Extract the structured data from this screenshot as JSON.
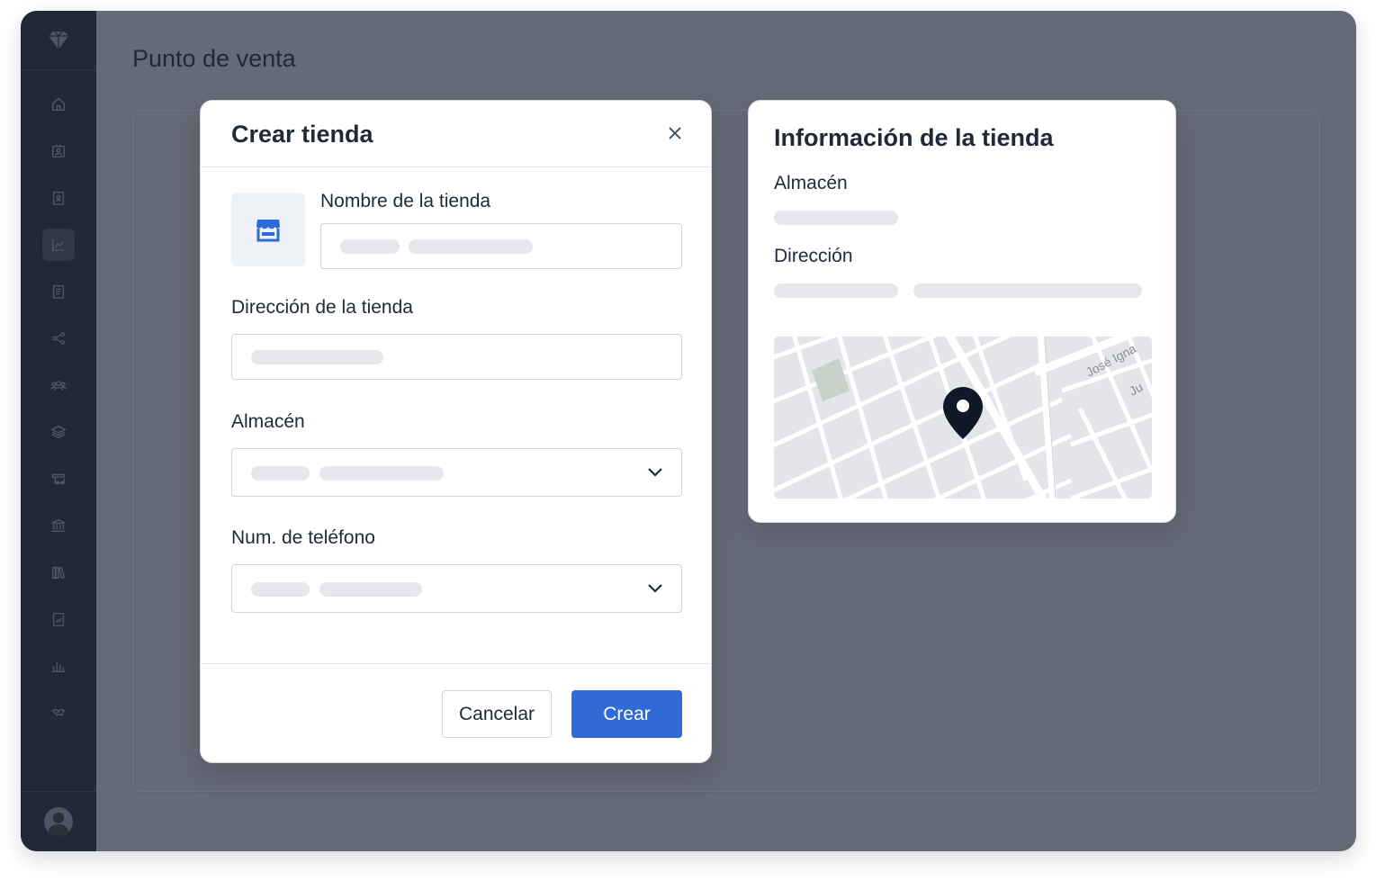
{
  "page": {
    "title": "Punto de venta"
  },
  "sidebar": {
    "logo_icon": "diamond-logo-icon",
    "items": [
      {
        "icon": "home-icon"
      },
      {
        "icon": "id-card-icon"
      },
      {
        "icon": "contact-icon"
      },
      {
        "icon": "chart-icon",
        "active": true
      },
      {
        "icon": "document-icon"
      },
      {
        "icon": "share-icon"
      },
      {
        "icon": "users-icon"
      },
      {
        "icon": "layers-icon"
      },
      {
        "icon": "truck-icon"
      },
      {
        "icon": "bank-icon"
      },
      {
        "icon": "books-icon"
      },
      {
        "icon": "file-chart-icon"
      },
      {
        "icon": "bar-chart-icon"
      },
      {
        "icon": "handshake-icon"
      }
    ],
    "user_avatar": "user-avatar"
  },
  "modal": {
    "title": "Crear tienda",
    "close_icon": "close-icon",
    "store_icon": "store-icon",
    "fields": {
      "name_label": "Nombre de la tienda",
      "address_label": "Dirección de la tienda",
      "warehouse_label": "Almacén",
      "phone_label": "Num. de teléfono"
    },
    "buttons": {
      "cancel": "Cancelar",
      "create": "Crear"
    }
  },
  "info_card": {
    "title": "Información de la tienda",
    "warehouse_label": "Almacén",
    "address_label": "Dirección",
    "map": {
      "street_label_1": "José Igna",
      "street_label_2": "Ju",
      "pin_icon": "map-pin-icon"
    }
  },
  "colors": {
    "primary": "#2f6ad6",
    "sidebar": "#1f2937",
    "overlay": "#646a76",
    "skeleton": "#e5e7eb"
  }
}
